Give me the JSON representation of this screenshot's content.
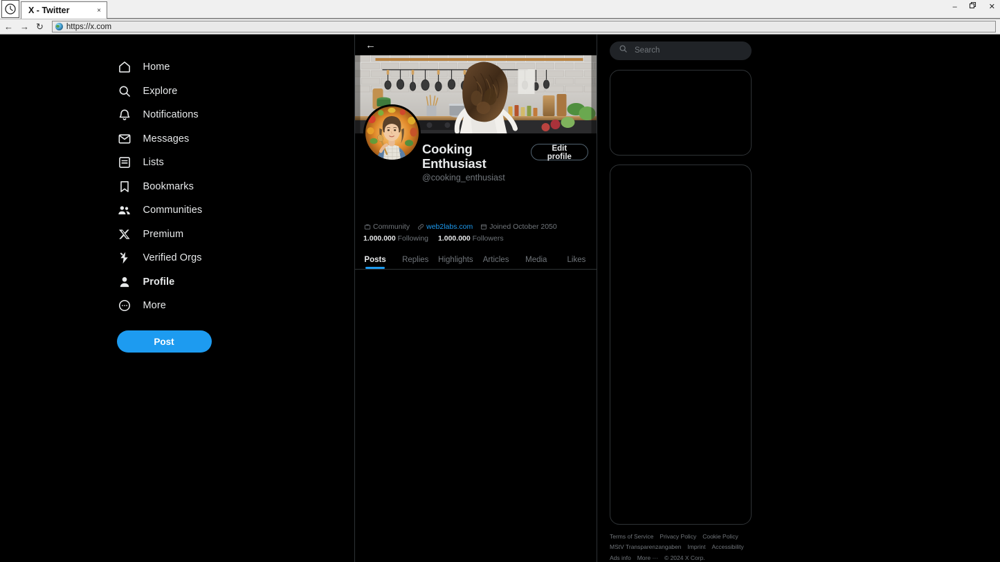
{
  "browser": {
    "app_icon": "clock-icon",
    "tab_title": "X - Twitter",
    "tab_close": "×",
    "back": "←",
    "forward": "→",
    "reload": "↻",
    "url": "https://x.com",
    "minimize": "–",
    "restore": "❐",
    "close": "✕"
  },
  "sidebar": {
    "items": [
      {
        "label": "Home",
        "icon": "home-icon",
        "active": false
      },
      {
        "label": "Explore",
        "icon": "search-icon",
        "active": false
      },
      {
        "label": "Notifications",
        "icon": "bell-icon",
        "active": false
      },
      {
        "label": "Messages",
        "icon": "envelope-icon",
        "active": false
      },
      {
        "label": "Lists",
        "icon": "list-icon",
        "active": false
      },
      {
        "label": "Bookmarks",
        "icon": "bookmark-icon",
        "active": false
      },
      {
        "label": "Communities",
        "icon": "people-icon",
        "active": false
      },
      {
        "label": "Premium",
        "icon": "x-logo-icon",
        "active": false
      },
      {
        "label": "Verified Orgs",
        "icon": "lightning-badge-icon",
        "active": false
      },
      {
        "label": "Profile",
        "icon": "person-icon",
        "active": true
      },
      {
        "label": "More",
        "icon": "more-circle-icon",
        "active": false
      }
    ],
    "post_button": "Post"
  },
  "profile": {
    "back_arrow": "←",
    "banner_alt": "kitchen-banner-image",
    "avatar_alt": "cooking-enthusiast-avatar",
    "display_name": "Cooking Enthusiast",
    "handle": "@cooking_enthusiast",
    "edit_button": "Edit profile",
    "meta": {
      "community": "Community",
      "website": "web2labs.com",
      "joined": "Joined October 2050"
    },
    "stats": {
      "following_count": "1.000.000",
      "following_label": "Following",
      "followers_count": "1.000.000",
      "followers_label": "Followers"
    },
    "tabs": [
      {
        "label": "Posts",
        "active": true
      },
      {
        "label": "Replies",
        "active": false
      },
      {
        "label": "Highlights",
        "active": false
      },
      {
        "label": "Articles",
        "active": false
      },
      {
        "label": "Media",
        "active": false
      },
      {
        "label": "Likes",
        "active": false
      }
    ]
  },
  "right": {
    "search_placeholder": "Search",
    "search_value": "",
    "footer_links": [
      "Terms of Service",
      "Privacy Policy",
      "Cookie Policy",
      "MStV Transparenzangaben",
      "Imprint",
      "Accessibility",
      "Ads info",
      "More ···"
    ],
    "copyright": "© 2024 X Corp."
  },
  "colors": {
    "accent": "#1d9bf0",
    "background": "#000000",
    "text": "#e7e9ea",
    "muted": "#71767b",
    "border": "#2f3336"
  }
}
